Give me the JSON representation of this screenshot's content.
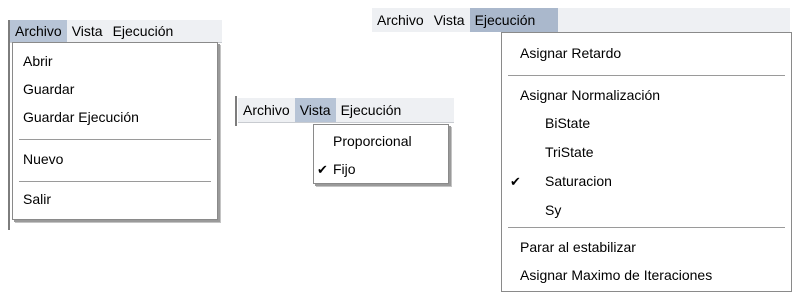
{
  "panel1": {
    "menubar": [
      "Archivo",
      "Vista",
      "Ejecución"
    ],
    "menu": [
      "Abrir",
      "Guardar",
      "Guardar Ejecución",
      "Nuevo",
      "Salir"
    ]
  },
  "panel2": {
    "menubar": [
      "Archivo",
      "Vista",
      "Ejecución"
    ],
    "menu": [
      "Proporcional",
      "Fijo"
    ],
    "checked": "Fijo"
  },
  "panel3": {
    "menubar": [
      "Archivo",
      "Vista",
      "Ejecución"
    ],
    "menu": {
      "assign_delay": "Asignar Retardo",
      "assign_normalization": "Asignar Normalización",
      "options": [
        "BiState",
        "TriState",
        "Saturacion",
        "Sy"
      ],
      "checked": "Saturacion",
      "stop_on_stabilize": "Parar al estabilizar",
      "assign_max_iterations": "Asignar Maximo de Iteraciones"
    }
  },
  "check_glyph": "✔"
}
